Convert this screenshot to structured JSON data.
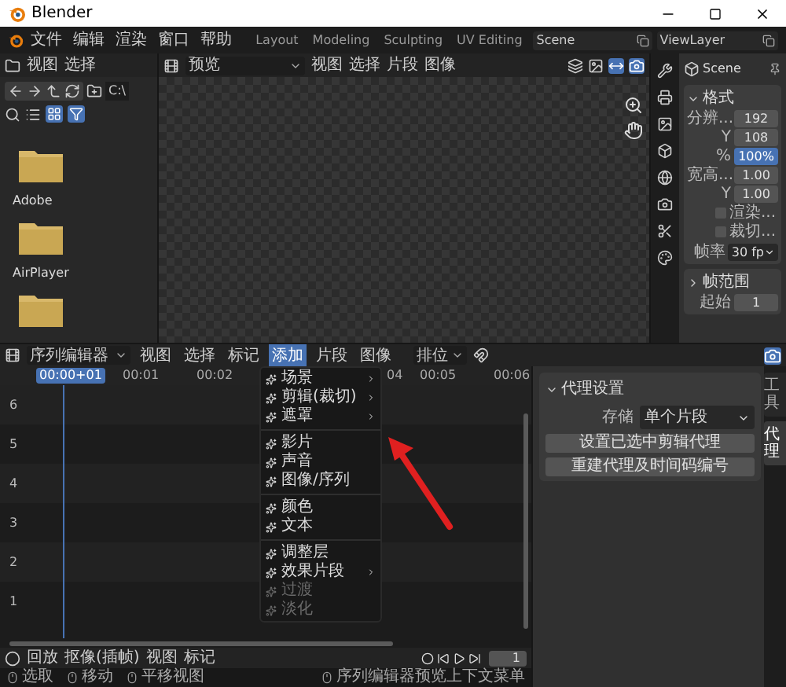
{
  "window": {
    "title": "Blender"
  },
  "menubar": [
    "文件",
    "编辑",
    "渲染",
    "窗口",
    "帮助"
  ],
  "workspaces": [
    {
      "label": "Layout",
      "selected": false
    },
    {
      "label": "Modeling",
      "selected": false
    },
    {
      "label": "Sculpting",
      "selected": false
    },
    {
      "label": "UV Editing",
      "selected": false
    }
  ],
  "scene": "Scene",
  "view_layer": "ViewLayer",
  "file_browser": {
    "menus": [
      "视图",
      "选择"
    ],
    "path": "C:\\",
    "items": [
      {
        "kind": "folder",
        "name": "Adobe"
      },
      {
        "kind": "folder",
        "name": "AirPlayer"
      },
      {
        "kind": "folder"
      }
    ]
  },
  "preview": {
    "mode": "预览",
    "menus": [
      "视图",
      "选择",
      "片段",
      "图像"
    ]
  },
  "properties": {
    "context": "Scene",
    "panels": [
      {
        "title": "格式",
        "expanded": true,
        "rows": [
          {
            "kind": "field",
            "label": "分辨...",
            "value": "192",
            "selected": false
          },
          {
            "kind": "field",
            "label": "Y",
            "value": "108",
            "selected": false
          },
          {
            "kind": "field",
            "label": "%",
            "value": "100%",
            "selected": true
          },
          {
            "kind": "field",
            "label": "宽高...",
            "value": "1.00",
            "selected": false
          },
          {
            "kind": "field",
            "label": "Y",
            "value": "1.00",
            "selected": false
          },
          {
            "kind": "checkbox",
            "label": "渲染...",
            "checked": false
          },
          {
            "kind": "checkbox",
            "label": "裁切...",
            "checked": false
          },
          {
            "kind": "dropdown",
            "label": "帧率",
            "value": "30 fp"
          }
        ]
      },
      {
        "title": "帧范围",
        "expanded": false,
        "rows": [
          {
            "kind": "field",
            "label": "起始",
            "value": "1",
            "selected": false
          }
        ]
      }
    ]
  },
  "sequencer": {
    "editor": "序列编辑器",
    "menus": [
      {
        "label": "视图",
        "selected": false
      },
      {
        "label": "选择",
        "selected": false
      },
      {
        "label": "标记",
        "selected": false
      },
      {
        "label": "添加",
        "selected": true
      },
      {
        "label": "片段",
        "selected": false
      },
      {
        "label": "图像",
        "selected": false
      }
    ],
    "snap": "排位",
    "current_time": "00:00+01",
    "ticks": [
      "00:01",
      "00:02",
      "04",
      "00:05",
      "00:06"
    ],
    "channels": [
      "6",
      "5",
      "4",
      "3",
      "2",
      "1"
    ]
  },
  "add_menu": [
    {
      "kind": "item",
      "label": "场景",
      "submenu": true,
      "disabled": false
    },
    {
      "kind": "item",
      "label": "剪辑(裁切)",
      "submenu": true,
      "disabled": false
    },
    {
      "kind": "item",
      "label": "遮罩",
      "submenu": true,
      "disabled": false
    },
    {
      "kind": "separator"
    },
    {
      "kind": "item",
      "label": "影片",
      "submenu": false,
      "disabled": false
    },
    {
      "kind": "item",
      "label": "声音",
      "submenu": false,
      "disabled": false
    },
    {
      "kind": "item",
      "label": "图像/序列",
      "submenu": false,
      "disabled": false
    },
    {
      "kind": "separator"
    },
    {
      "kind": "item",
      "label": "颜色",
      "submenu": false,
      "disabled": false
    },
    {
      "kind": "item",
      "label": "文本",
      "submenu": false,
      "disabled": false
    },
    {
      "kind": "separator"
    },
    {
      "kind": "item",
      "label": "调整层",
      "submenu": false,
      "disabled": false
    },
    {
      "kind": "item",
      "label": "效果片段",
      "submenu": true,
      "disabled": false
    },
    {
      "kind": "item",
      "label": "过渡",
      "submenu": false,
      "disabled": true
    },
    {
      "kind": "item",
      "label": "淡化",
      "submenu": false,
      "disabled": true
    }
  ],
  "sidebar": {
    "panel": "代理设置",
    "expanded": true,
    "storage_label": "存储",
    "storage": "单个片段",
    "buttons": [
      "设置已选中剪辑代理",
      "重建代理及时间码编号"
    ],
    "tabs": [
      {
        "label": "工具",
        "selected": false
      },
      {
        "label": "代理",
        "selected": true
      }
    ]
  },
  "playback": {
    "menus": [
      "回放",
      "抠像(插帧)",
      "视图",
      "标记"
    ],
    "frame": "1"
  },
  "status_bar": [
    "选取",
    "移动",
    "平移视图",
    "序列编辑器预览上下文菜单"
  ]
}
